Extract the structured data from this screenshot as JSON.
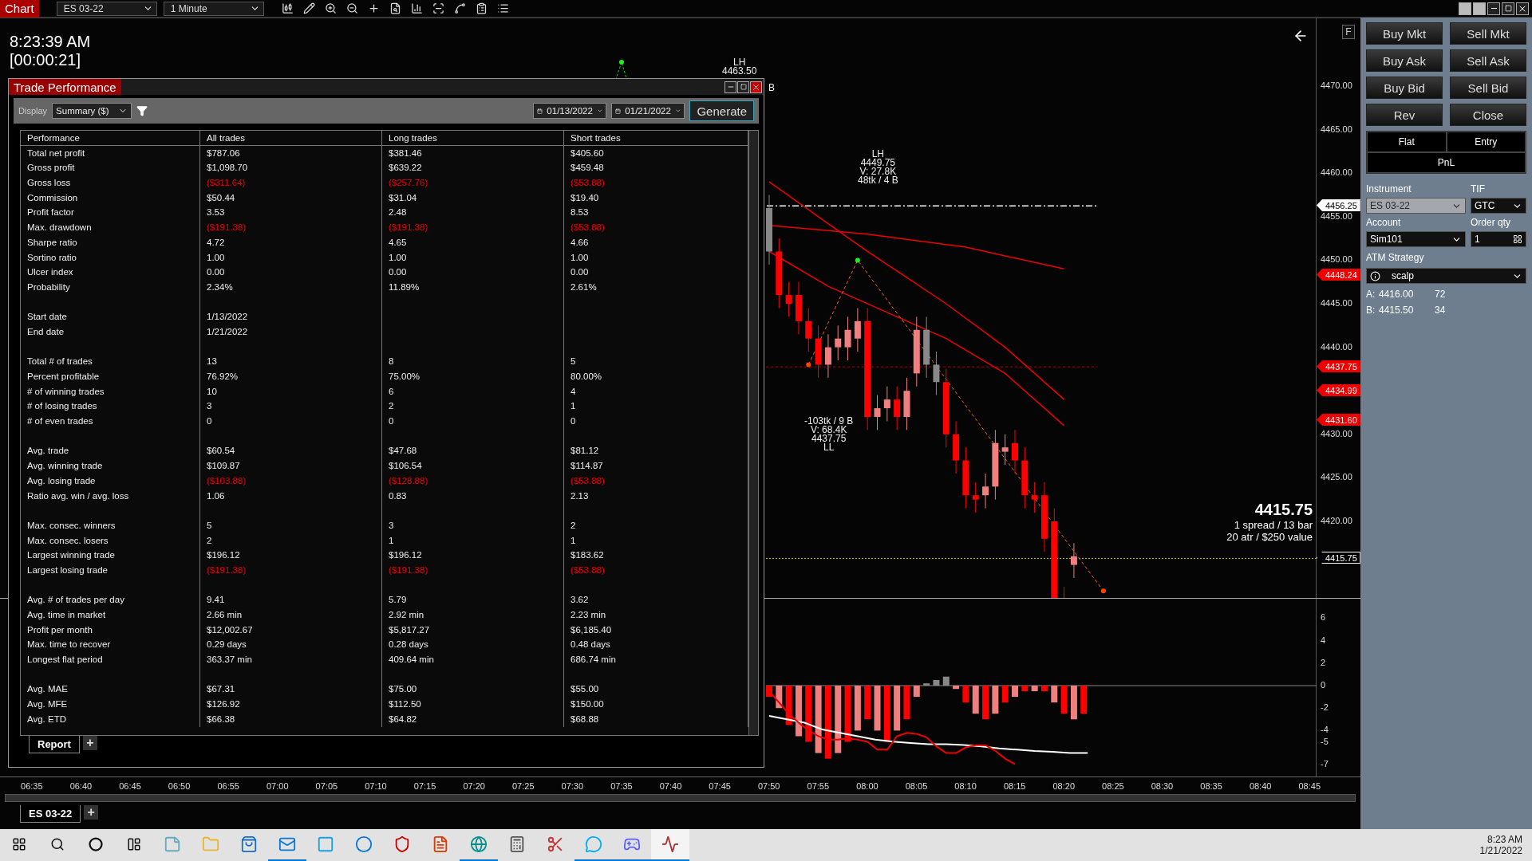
{
  "top_bar": {
    "title": "Chart",
    "instrument": "ES 03-22",
    "interval": "1 Minute"
  },
  "clock": {
    "time": "8:23:39 AM",
    "timer": "[00:00:21]"
  },
  "chart": {
    "flag_button": "F",
    "price_labels": [
      "4470.00",
      "4465.00",
      "4460.00",
      "4455.00",
      "4450.00",
      "4445.00",
      "4440.00",
      "4430.00",
      "4425.00",
      "4420.00"
    ],
    "price_markers": [
      {
        "label": "4456.25",
        "kind": "line"
      },
      {
        "label": "4448.24",
        "kind": "level"
      },
      {
        "label": "4437.75",
        "kind": "level"
      },
      {
        "label": "4434.99",
        "kind": "level"
      },
      {
        "label": "4431.60",
        "kind": "level"
      },
      {
        "label": "4415.75",
        "kind": "last"
      }
    ],
    "annotations": [
      {
        "lines": [
          "LH",
          "4463.50"
        ]
      },
      {
        "lines": [
          "B"
        ]
      },
      {
        "lines": [
          "LH",
          "4449.75",
          "V: 27.8K",
          "48tk / 4 B"
        ]
      },
      {
        "lines": [
          "-103tk / 9 B",
          "V: 68.4K",
          "4437.75",
          "LL"
        ]
      }
    ],
    "last_price": {
      "price": "4415.75",
      "line_1": "1 spread / 13 bar",
      "line_2": "20 atr / $250 value"
    },
    "indicator_labels": [
      "6",
      "4",
      "2",
      "0",
      "-2",
      "-4",
      "-5",
      "-7"
    ],
    "time_labels": [
      "06:35",
      "06:40",
      "06:45",
      "06:50",
      "06:55",
      "07:00",
      "07:05",
      "07:10",
      "07:15",
      "07:20",
      "07:25",
      "07:30",
      "07:35",
      "07:40",
      "07:45",
      "07:50",
      "07:55",
      "08:00",
      "08:05",
      "08:10",
      "08:15",
      "08:20",
      "08:25",
      "08:30",
      "08:35",
      "08:40",
      "08:45"
    ],
    "tabs": [
      {
        "label": "ES 03-22",
        "selected": true
      }
    ],
    "add_tab": "+"
  },
  "trade_performance": {
    "title": "Trade Performance",
    "display_label": "Display",
    "display_value": "Summary ($)",
    "date_from": "01/13/2022",
    "date_to": "01/21/2022",
    "generate": "Generate",
    "columns": [
      "Performance",
      "All trades",
      "Long trades",
      "Short trades"
    ],
    "rows": [
      {
        "kind": "stat",
        "label": "Total net profit",
        "values": [
          "$787.06",
          "$381.46",
          "$405.60"
        ],
        "negative": false
      },
      {
        "kind": "stat",
        "label": "Gross profit",
        "values": [
          "$1,098.70",
          "$639.22",
          "$459.48"
        ],
        "negative": false
      },
      {
        "kind": "stat",
        "label": "Gross loss",
        "values": [
          "($311.64)",
          "($257.76)",
          "($53.88)"
        ],
        "negative": true
      },
      {
        "kind": "stat",
        "label": "Commission",
        "values": [
          "$50.44",
          "$31.04",
          "$19.40"
        ],
        "negative": false
      },
      {
        "kind": "stat",
        "label": "Profit factor",
        "values": [
          "3.53",
          "2.48",
          "8.53"
        ],
        "negative": false
      },
      {
        "kind": "stat",
        "label": "Max. drawdown",
        "values": [
          "($191.38)",
          "($191.38)",
          "($53.88)"
        ],
        "negative": true
      },
      {
        "kind": "stat",
        "label": "Sharpe ratio",
        "values": [
          "4.72",
          "4.65",
          "4.66"
        ],
        "negative": false
      },
      {
        "kind": "stat",
        "label": "Sortino ratio",
        "values": [
          "1.00",
          "1.00",
          "1.00"
        ],
        "negative": false
      },
      {
        "kind": "stat",
        "label": "Ulcer index",
        "values": [
          "0.00",
          "0.00",
          "0.00"
        ],
        "negative": false
      },
      {
        "kind": "stat",
        "label": "Probability",
        "values": [
          "2.34%",
          "11.89%",
          "2.61%"
        ],
        "negative": false
      },
      {
        "kind": "gap"
      },
      {
        "kind": "stat",
        "label": "Start date",
        "values": [
          "1/13/2022"
        ],
        "negative": false
      },
      {
        "kind": "stat",
        "label": "End date",
        "values": [
          "1/21/2022"
        ],
        "negative": false
      },
      {
        "kind": "gap"
      },
      {
        "kind": "stat",
        "label": "Total # of trades",
        "values": [
          "13",
          "8",
          "5"
        ],
        "negative": false
      },
      {
        "kind": "stat",
        "label": "Percent profitable",
        "values": [
          "76.92%",
          "75.00%",
          "80.00%"
        ],
        "negative": false
      },
      {
        "kind": "stat",
        "label": "# of winning trades",
        "values": [
          "10",
          "6",
          "4"
        ],
        "negative": false
      },
      {
        "kind": "stat",
        "label": "# of losing trades",
        "values": [
          "3",
          "2",
          "1"
        ],
        "negative": false
      },
      {
        "kind": "stat",
        "label": "# of even trades",
        "values": [
          "0",
          "0",
          "0"
        ],
        "negative": false
      },
      {
        "kind": "gap"
      },
      {
        "kind": "stat",
        "label": "Avg. trade",
        "values": [
          "$60.54",
          "$47.68",
          "$81.12"
        ],
        "negative": false
      },
      {
        "kind": "stat",
        "label": "Avg. winning trade",
        "values": [
          "$109.87",
          "$106.54",
          "$114.87"
        ],
        "negative": false
      },
      {
        "kind": "stat",
        "label": "Avg. losing trade",
        "values": [
          "($103.88)",
          "($128.88)",
          "($53.88)"
        ],
        "negative": true
      },
      {
        "kind": "stat",
        "label": "Ratio avg. win / avg. loss",
        "values": [
          "1.06",
          "0.83",
          "2.13"
        ],
        "negative": false
      },
      {
        "kind": "gap"
      },
      {
        "kind": "stat",
        "label": "Max. consec. winners",
        "values": [
          "5",
          "3",
          "2"
        ],
        "negative": false
      },
      {
        "kind": "stat",
        "label": "Max. consec. losers",
        "values": [
          "2",
          "1",
          "1"
        ],
        "negative": false
      },
      {
        "kind": "stat",
        "label": "Largest winning trade",
        "values": [
          "$196.12",
          "$196.12",
          "$183.62"
        ],
        "negative": false
      },
      {
        "kind": "stat",
        "label": "Largest losing trade",
        "values": [
          "($191.38)",
          "($191.38)",
          "($53.88)"
        ],
        "negative": true
      },
      {
        "kind": "gap"
      },
      {
        "kind": "stat",
        "label": "Avg. # of trades per day",
        "values": [
          "9.41",
          "5.79",
          "3.62"
        ],
        "negative": false
      },
      {
        "kind": "stat",
        "label": "Avg. time in market",
        "values": [
          "2.66 min",
          "2.92 min",
          "2.23 min"
        ],
        "negative": false
      },
      {
        "kind": "stat",
        "label": "Profit per month",
        "values": [
          "$12,002.67",
          "$5,817.27",
          "$6,185.40"
        ],
        "negative": false
      },
      {
        "kind": "stat",
        "label": "Max. time to recover",
        "values": [
          "0.29 days",
          "0.28 days",
          "0.48 days"
        ],
        "negative": false
      },
      {
        "kind": "stat",
        "label": "Longest flat period",
        "values": [
          "363.37 min",
          "409.64 min",
          "686.74 min"
        ],
        "negative": false
      },
      {
        "kind": "gap"
      },
      {
        "kind": "stat",
        "label": "Avg. MAE",
        "values": [
          "$67.31",
          "$75.00",
          "$55.00"
        ],
        "negative": false
      },
      {
        "kind": "stat",
        "label": "Avg. MFE",
        "values": [
          "$126.92",
          "$112.50",
          "$150.00"
        ],
        "negative": false
      },
      {
        "kind": "stat",
        "label": "Avg. ETD",
        "values": [
          "$66.38",
          "$64.82",
          "$68.88"
        ],
        "negative": false
      }
    ],
    "tabs": [
      {
        "label": "Report",
        "selected": true
      }
    ],
    "add_tab": "+"
  },
  "order_panel": {
    "buttons": [
      "Buy Mkt",
      "Sell Mkt",
      "Buy Ask",
      "Sell Ask",
      "Buy Bid",
      "Sell Bid",
      "Rev",
      "Close"
    ],
    "position": [
      "Flat",
      "Entry",
      "PnL"
    ],
    "fields": [
      {
        "label": "Instrument",
        "value": "ES 03-22",
        "disabled": true
      },
      {
        "label": "TIF",
        "value": "GTC",
        "disabled": false
      },
      {
        "label": "Account",
        "value": "Sim101",
        "disabled": false
      },
      {
        "label": "Order qty",
        "value": "1",
        "disabled": false
      }
    ],
    "atm_label": "ATM Strategy",
    "atm_value": "scalp",
    "quotes": [
      {
        "side": "A:",
        "price": "4416.00",
        "size": "72"
      },
      {
        "side": "B:",
        "price": "4415.50",
        "size": "34"
      }
    ]
  },
  "taskbar": {
    "apps": [
      {
        "running": false,
        "focused": false
      },
      {
        "running": false,
        "focused": false
      },
      {
        "running": false,
        "focused": false
      },
      {
        "running": true,
        "focused": false
      },
      {
        "running": false,
        "focused": false
      },
      {
        "running": false,
        "focused": false
      },
      {
        "running": false,
        "focused": false
      },
      {
        "running": false,
        "focused": false
      },
      {
        "running": true,
        "focused": false
      },
      {
        "running": false,
        "focused": false
      },
      {
        "running": false,
        "focused": false
      },
      {
        "running": true,
        "focused": false
      },
      {
        "running": true,
        "focused": false
      },
      {
        "running": true,
        "focused": true
      }
    ],
    "time": "8:23 AM",
    "date": "1/21/2022"
  }
}
